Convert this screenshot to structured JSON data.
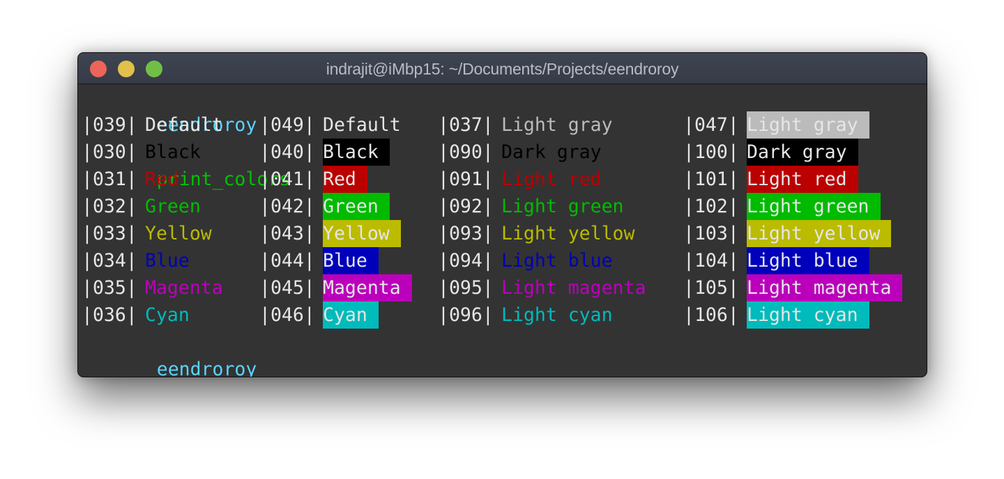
{
  "window": {
    "title": "indrajit@iMbp15: ~/Documents/Projects/eendroroy",
    "buttons": [
      "close",
      "minimize",
      "maximize"
    ]
  },
  "prompt": {
    "user": "eendroroy",
    "command": "print_colors"
  },
  "colors": {
    "prompt_user": "#5ad4ff",
    "prompt_command": "#00c200",
    "default_fg": "#e6e6e6",
    "background": "#333333"
  },
  "columns": [
    {
      "kind": "foreground",
      "rows": [
        {
          "code": "|039|",
          "label": "Default",
          "fg": "#e6e6e6",
          "bg": null
        },
        {
          "code": "|030|",
          "label": "Black",
          "fg": "#000000",
          "bg": null
        },
        {
          "code": "|031|",
          "label": "Red",
          "fg": "#c00000",
          "bg": null
        },
        {
          "code": "|032|",
          "label": "Green",
          "fg": "#00bb00",
          "bg": null
        },
        {
          "code": "|033|",
          "label": "Yellow",
          "fg": "#bbbb00",
          "bg": null
        },
        {
          "code": "|034|",
          "label": "Blue",
          "fg": "#0000bb",
          "bg": null
        },
        {
          "code": "|035|",
          "label": "Magenta",
          "fg": "#bb00bb",
          "bg": null
        },
        {
          "code": "|036|",
          "label": "Cyan",
          "fg": "#00bbbb",
          "bg": null
        }
      ]
    },
    {
      "kind": "background",
      "rows": [
        {
          "code": "|049|",
          "label": "Default",
          "fg": "#e6e6e6",
          "bg": null
        },
        {
          "code": "|040|",
          "label": "Black",
          "fg": "#e6e6e6",
          "bg": "#000000"
        },
        {
          "code": "|041|",
          "label": "Red",
          "fg": "#e6e6e6",
          "bg": "#bb0000"
        },
        {
          "code": "|042|",
          "label": "Green",
          "fg": "#e6e6e6",
          "bg": "#00bb00"
        },
        {
          "code": "|043|",
          "label": "Yellow",
          "fg": "#e6e6e6",
          "bg": "#bbbb00"
        },
        {
          "code": "|044|",
          "label": "Blue",
          "fg": "#e6e6e6",
          "bg": "#0000bb"
        },
        {
          "code": "|045|",
          "label": "Magenta",
          "fg": "#e6e6e6",
          "bg": "#bb00bb"
        },
        {
          "code": "|046|",
          "label": "Cyan",
          "fg": "#e6e6e6",
          "bg": "#00bbbb"
        }
      ]
    },
    {
      "kind": "foreground-light",
      "rows": [
        {
          "code": "|037|",
          "label": "Light gray",
          "fg": "#bbbbbb",
          "bg": null
        },
        {
          "code": "|090|",
          "label": "Dark gray",
          "fg": "#000000",
          "bg": null
        },
        {
          "code": "|091|",
          "label": "Light red",
          "fg": "#bb0000",
          "bg": null
        },
        {
          "code": "|092|",
          "label": "Light green",
          "fg": "#00bb00",
          "bg": null
        },
        {
          "code": "|093|",
          "label": "Light yellow",
          "fg": "#bbbb00",
          "bg": null
        },
        {
          "code": "|094|",
          "label": "Light blue",
          "fg": "#0000bb",
          "bg": null
        },
        {
          "code": "|095|",
          "label": "Light magenta",
          "fg": "#bb00bb",
          "bg": null
        },
        {
          "code": "|096|",
          "label": "Light cyan",
          "fg": "#00bbbb",
          "bg": null
        }
      ]
    },
    {
      "kind": "background-light",
      "rows": [
        {
          "code": "|047|",
          "label": "Light gray",
          "fg": "#e6e6e6",
          "bg": "#bbbbbb"
        },
        {
          "code": "|100|",
          "label": "Dark gray",
          "fg": "#e6e6e6",
          "bg": "#000000"
        },
        {
          "code": "|101|",
          "label": "Light red",
          "fg": "#e6e6e6",
          "bg": "#bb0000"
        },
        {
          "code": "|102|",
          "label": "Light green",
          "fg": "#e6e6e6",
          "bg": "#00bb00"
        },
        {
          "code": "|103|",
          "label": "Light yellow",
          "fg": "#e6e6e6",
          "bg": "#bbbb00"
        },
        {
          "code": "|104|",
          "label": "Light blue",
          "fg": "#e6e6e6",
          "bg": "#0000bb"
        },
        {
          "code": "|105|",
          "label": "Light magenta",
          "fg": "#e6e6e6",
          "bg": "#bb00bb"
        },
        {
          "code": "|106|",
          "label": "Light cyan",
          "fg": "#e6e6e6",
          "bg": "#00bbbb"
        }
      ]
    }
  ],
  "final_prompt": {
    "user": "eendroroy"
  }
}
